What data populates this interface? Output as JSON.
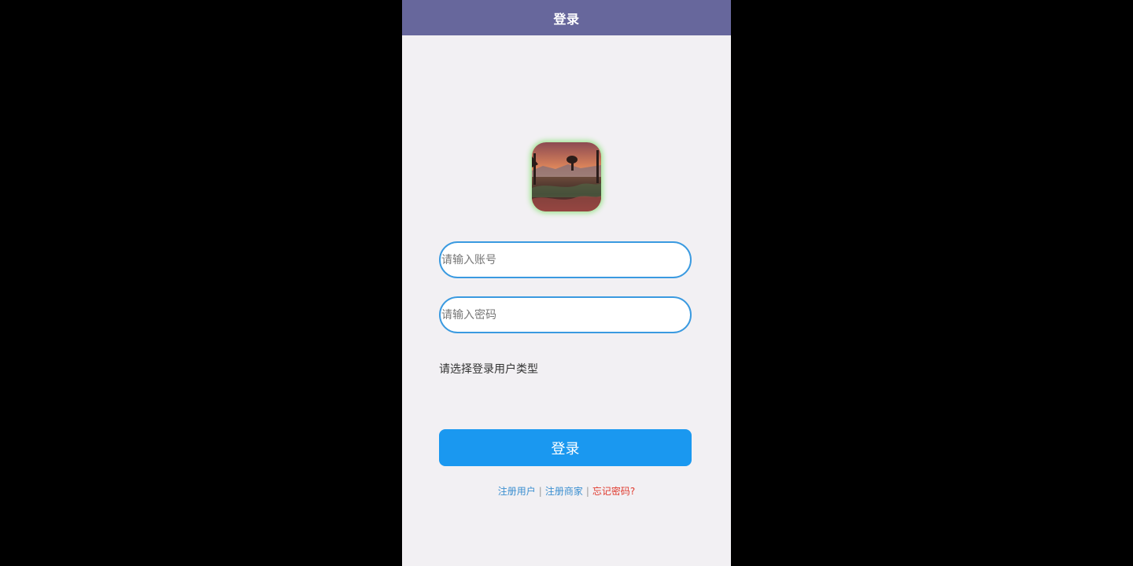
{
  "header": {
    "title": "登录"
  },
  "avatar": {
    "icon": "landscape-photo-icon",
    "glow_color": "#9be38c"
  },
  "form": {
    "account_placeholder": "请输入账号",
    "account_value": "",
    "password_placeholder": "请输入密码",
    "password_value": "",
    "user_type_label": "请选择登录用户类型",
    "login_button_label": "登录"
  },
  "links": {
    "register_user": "注册用户",
    "separator_1": "|",
    "register_merchant": "注册商家",
    "separator_2": "|",
    "forgot_password": "忘记密码?"
  },
  "colors": {
    "header_bg": "#67679c",
    "page_bg": "#f2f0f3",
    "input_border": "#3a9ae0",
    "button_bg": "#1a98f0",
    "link_blue": "#3b8fd0",
    "link_red": "#e03a2e"
  }
}
